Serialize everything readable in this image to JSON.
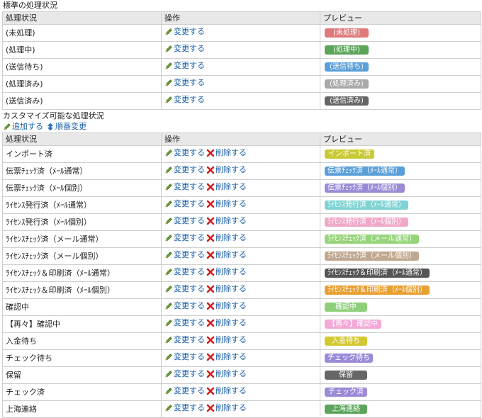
{
  "standard": {
    "title": "標準の処理状況",
    "headers": [
      "処理状況",
      "操作",
      "プレビュー"
    ],
    "rows": [
      {
        "name": "(未処理)",
        "change": "変更する",
        "badge": "(未処理)",
        "color": "#e07a7a",
        "w": 62
      },
      {
        "name": "(処理中)",
        "change": "変更する",
        "badge": "(処理中)",
        "color": "#5aa55a",
        "w": 62
      },
      {
        "name": "(送信待ち)",
        "change": "変更する",
        "badge": "(送信待ち)",
        "color": "#5a9fd8",
        "w": 62
      },
      {
        "name": "(処理済み)",
        "change": "変更する",
        "badge": "(処理済み)",
        "color": "#a8a8a8",
        "w": 62
      },
      {
        "name": "(送信済み)",
        "change": "変更する",
        "badge": "(送信済み)",
        "color": "#666666",
        "w": 62
      }
    ]
  },
  "custom": {
    "title": "カスタマイズ可能な処理状況",
    "add_label": "追加する",
    "reorder_label": "順番変更",
    "headers": [
      "処理状況",
      "操作",
      "プレビュー"
    ],
    "rows": [
      {
        "name": "インポート済",
        "change": "変更する",
        "delete": "削除する",
        "badge": "インポート済",
        "color": "#c9c935",
        "w": 70
      },
      {
        "name": "伝票ﾁｪｯｸ済（ﾒｰﾙ通常）",
        "change": "変更する",
        "delete": "削除する",
        "badge": "伝票ﾁｪｯｸ済（ﾒｰﾙ通常）",
        "color": "#5a9fd8",
        "w": 111
      },
      {
        "name": "伝票ﾁｪｯｸ済（ﾒｰﾙ個別）",
        "change": "変更する",
        "delete": "削除する",
        "badge": "伝票ﾁｪｯｸ済（ﾒｰﾙ個別）",
        "color": "#9b8ad6",
        "w": 111
      },
      {
        "name": "ﾗｲｾﾝｽ発行済（ﾒｰﾙ通常）",
        "change": "変更する",
        "delete": "削除する",
        "badge": "ﾗｲｾﾝｽ発行済（ﾒｰﾙ通常）",
        "color": "#7fd3d3",
        "w": 111
      },
      {
        "name": "ﾗｲｾﾝｽ発行済（ﾒｰﾙ個別）",
        "change": "変更する",
        "delete": "削除する",
        "badge": "ﾗｲｾﾝｽ発行済（ﾒｰﾙ個別）",
        "color": "#f0a8c8",
        "w": 111
      },
      {
        "name": "ﾗｲｾﾝｽﾁｪｯｸ済（メール通常）",
        "change": "変更する",
        "delete": "削除する",
        "badge": "ﾗｲｾﾝｽﾁｪｯｸ済（メール通常）",
        "color": "#96d47a",
        "w": 124
      },
      {
        "name": "ﾗｲｾﾝｽﾁｪｯｸ済（メール個別）",
        "change": "変更する",
        "delete": "削除する",
        "badge": "ﾗｲｾﾝｽﾁｪｯｸ済（メール個別）",
        "color": "#c0a890",
        "w": 124
      },
      {
        "name": "ﾗｲｾﾝｽﾁｪｯｸ＆印刷済（ﾒｰﾙ通常）",
        "change": "変更する",
        "delete": "削除する",
        "badge": "ﾗｲｾﾝｽﾁｪｯｸ＆印刷済（ﾒｰﾙ通常）",
        "color": "#555555",
        "w": 140
      },
      {
        "name": "ﾗｲｾﾝｽﾁｪｯｸ＆印刷済（ﾒｰﾙ個別）",
        "change": "変更する",
        "delete": "削除する",
        "badge": "ﾗｲｾﾝｽﾁｪｯｸ＆印刷済（ﾒｰﾙ個別）",
        "color": "#e8a030",
        "w": 140
      },
      {
        "name": "確認中",
        "change": "変更する",
        "delete": "削除する",
        "badge": "確認中",
        "color": "#8ed07a",
        "w": 60
      },
      {
        "name": "【再々】確認中",
        "change": "変更する",
        "delete": "削除する",
        "badge": "【再々】確認中",
        "color": "#f4a8d8",
        "w": 80
      },
      {
        "name": "入金待ち",
        "change": "変更する",
        "delete": "削除する",
        "badge": "入金待ち",
        "color": "#d4c832",
        "w": 60
      },
      {
        "name": "チェック待ち",
        "change": "変更する",
        "delete": "削除する",
        "badge": "チェック待ち",
        "color": "#9b8ad6",
        "w": 68
      },
      {
        "name": "保留",
        "change": "変更する",
        "delete": "削除する",
        "badge": "保留",
        "color": "#666666",
        "w": 60
      },
      {
        "name": "チェック済",
        "change": "変更する",
        "delete": "削除する",
        "badge": "チェック済",
        "color": "#9b8ad6",
        "w": 60
      },
      {
        "name": "上海連絡",
        "change": "変更する",
        "delete": "削除する",
        "badge": "上海連絡",
        "color": "#5aa55a",
        "w": 60
      }
    ]
  },
  "icons": {
    "edit": "pencil-icon",
    "delete": "x-icon",
    "reorder": "up-down-arrow-icon"
  }
}
